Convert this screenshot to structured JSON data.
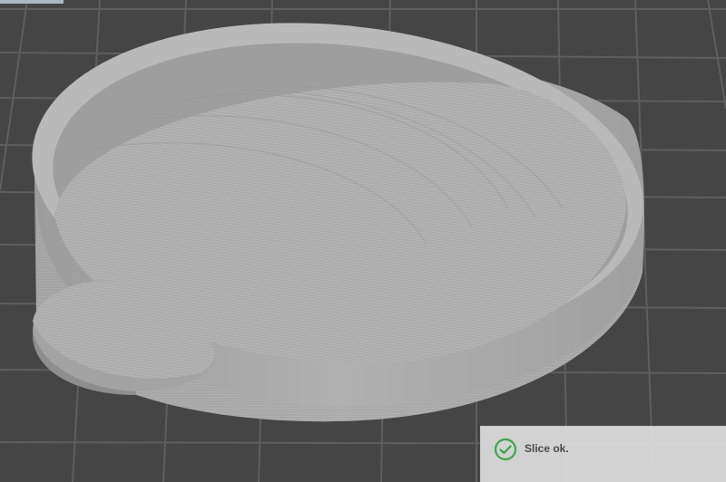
{
  "viewport": {
    "background_color": "#454545",
    "grid_color": "#5e5e5e",
    "model_color": "#a9a9a9"
  },
  "notification": {
    "message": "Slice ok.",
    "icon": "check-circle-icon",
    "icon_color": "#3aa64a"
  }
}
